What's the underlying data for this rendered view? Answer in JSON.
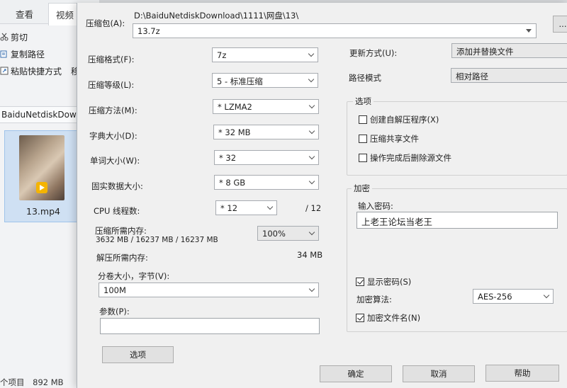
{
  "explorer": {
    "tabs": [
      "查看",
      "视频"
    ],
    "ribbon": {
      "cut": "剪切",
      "copy_path": "复制路径",
      "paste_shortcut": "粘贴快捷方式",
      "move_partial": "移"
    },
    "path": "BaiduNetdiskDown",
    "file": {
      "name": "13.mp4",
      "badge": "Player"
    },
    "status": {
      "count": "个项目",
      "size": "892 MB"
    }
  },
  "dialog": {
    "archive_label": "压缩包(A):",
    "archive_dir": "D:\\BaiduNetdiskDownload\\1111\\网盘\\13\\",
    "archive_name": "13.7z",
    "browse_label": "...",
    "left": {
      "format": {
        "label": "压缩格式(F):",
        "value": "7z"
      },
      "level": {
        "label": "压缩等级(L):",
        "value": "5 - 标准压缩"
      },
      "method": {
        "label": "压缩方法(M):",
        "value": "* LZMA2"
      },
      "dict": {
        "label": "字典大小(D):",
        "value": "* 32 MB"
      },
      "word": {
        "label": "单词大小(W):",
        "value": "* 32"
      },
      "solid": {
        "label": "固实数据大小:",
        "value": "* 8 GB"
      },
      "threads": {
        "label": "CPU 线程数:",
        "value": "* 12",
        "max": "/ 12"
      },
      "mem_compress": {
        "label": "压缩所需内存:",
        "value": "3632 MB / 16237 MB / 16237 MB",
        "percent": "100%"
      },
      "mem_decompress": {
        "label": "解压所需内存:",
        "value": "34 MB"
      },
      "volume": {
        "label": "分卷大小，字节(V):",
        "value": "100M"
      },
      "params": {
        "label": "参数(P):",
        "value": ""
      },
      "options_button": "选项"
    },
    "right": {
      "update": {
        "label": "更新方式(U):",
        "value": "添加并替换文件"
      },
      "path_mode": {
        "label": "路径模式",
        "value": "相对路径"
      },
      "options": {
        "title": "选项",
        "sfx": {
          "label": "创建自解压程序(X)",
          "checked": false
        },
        "shared": {
          "label": "压缩共享文件",
          "checked": false
        },
        "delete": {
          "label": "操作完成后删除源文件",
          "checked": false
        }
      },
      "encryption": {
        "title": "加密",
        "password_label": "输入密码:",
        "password": "上老王论坛当老王",
        "show_password": {
          "label": "显示密码(S)",
          "checked": true
        },
        "method_label": "加密算法:",
        "method": "AES-256",
        "encrypt_names": {
          "label": "加密文件名(N)",
          "checked": true
        }
      }
    },
    "buttons": {
      "ok": "确定",
      "cancel": "取消",
      "help": "帮助"
    }
  },
  "colors": {
    "dialog_bg": "#f0f0f0",
    "selection": "#cfe0f3"
  }
}
